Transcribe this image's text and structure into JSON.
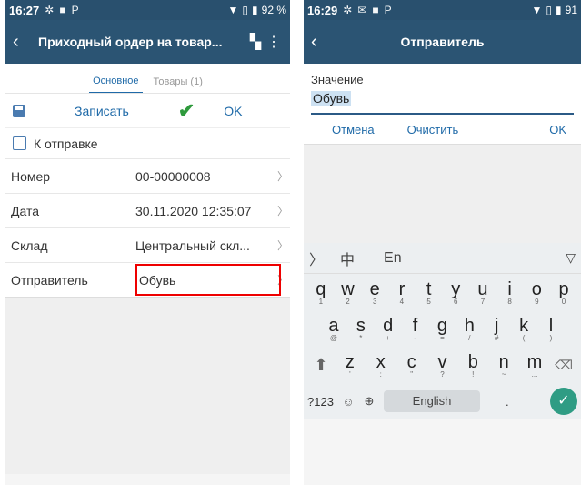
{
  "left": {
    "status": {
      "time": "16:27",
      "battery": "92 %"
    },
    "title": "Приходный ордер на товар...",
    "tabs": [
      "Основное",
      "Товары (1)"
    ],
    "toolbar": {
      "save": "Записать",
      "ok": "OK"
    },
    "check_label": "К отправке",
    "fields": [
      {
        "label": "Номер",
        "value": "00-00000008"
      },
      {
        "label": "Дата",
        "value": "30.11.2020 12:35:07"
      },
      {
        "label": "Склад",
        "value": "Центральный скл..."
      },
      {
        "label": "Отправитель",
        "value": "Обувь"
      }
    ]
  },
  "right": {
    "status": {
      "time": "16:29",
      "battery": "91"
    },
    "title": "Отправитель",
    "value_label": "Значение",
    "value": "Обувь",
    "actions": {
      "cancel": "Отмена",
      "clear": "Очистить",
      "ok": "OK"
    },
    "kb": {
      "zh": "中",
      "en": "En",
      "row1": [
        "q",
        "w",
        "e",
        "r",
        "t",
        "y",
        "u",
        "i",
        "o",
        "p"
      ],
      "row1_sub": [
        "1",
        "2",
        "3",
        "4",
        "5",
        "6",
        "7",
        "8",
        "9",
        "0"
      ],
      "row2": [
        "a",
        "s",
        "d",
        "f",
        "g",
        "h",
        "j",
        "k",
        "l"
      ],
      "row2_sub": [
        "@",
        "*",
        "+",
        "-",
        "=",
        "/",
        "#",
        "(",
        ")"
      ],
      "row3": [
        "z",
        "x",
        "c",
        "v",
        "b",
        "n",
        "m"
      ],
      "row3_sub": [
        "'",
        ":",
        "\"",
        "?",
        "!",
        "~",
        "..."
      ],
      "sym": "?123",
      "space": "English",
      "dot": "."
    }
  }
}
